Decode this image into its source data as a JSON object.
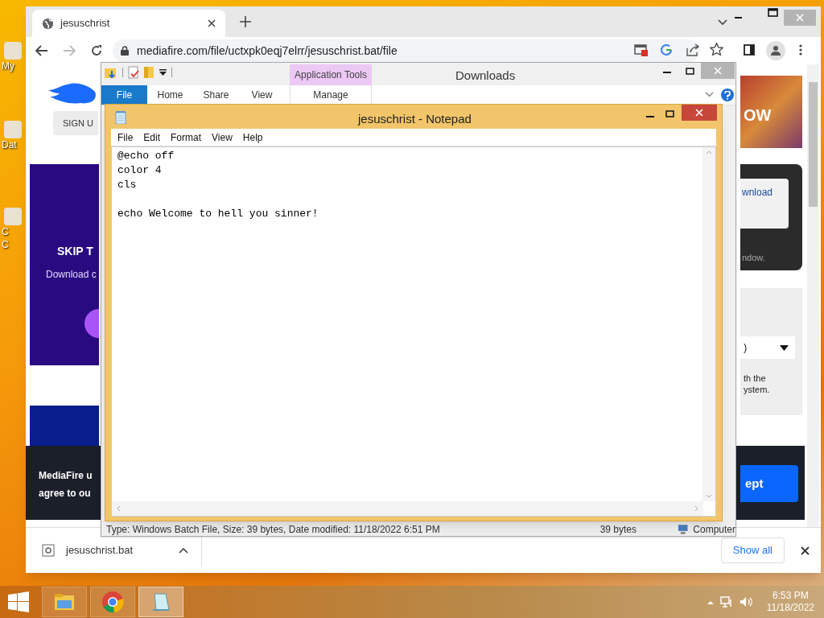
{
  "desktop_icons": [
    {
      "lines": [
        "My"
      ]
    },
    {
      "lines": [
        "Dat"
      ]
    },
    {
      "lines": [
        "C",
        "C"
      ]
    }
  ],
  "browser": {
    "tab": {
      "title": "jesuschrist",
      "selected": true
    },
    "url": "mediafire.com/file/uctxpk0eqj7elrr/jesuschrist.bat/file",
    "page": {
      "sign_up": "SIGN U",
      "promo_title": "SKIP T",
      "promo_text": "Download c",
      "cookie_text": [
        "MediaFire u",
        "agree to ou"
      ],
      "banner_text": "OW",
      "download_link": "wnload",
      "note": "ndow.",
      "select_value": ")",
      "info_text": [
        "th the",
        "ystem."
      ],
      "accept_button": "ept"
    },
    "downloads_bar": {
      "file": "jesuschrist.bat",
      "show_all": "Show all"
    }
  },
  "explorer": {
    "title": "Downloads",
    "tabs": [
      {
        "label": "File",
        "selected": true
      },
      {
        "label": "Home",
        "selected": false
      },
      {
        "label": "Share",
        "selected": false
      },
      {
        "label": "View",
        "selected": false
      }
    ],
    "context_group": "Application Tools",
    "context_tab": "Manage",
    "status": {
      "details": "Type: Windows Batch File, Size: 39 bytes, Date modified: 11/18/2022 6:51 PM",
      "size": "39 bytes",
      "location": "Computer"
    }
  },
  "notepad": {
    "title": "jesuschrist - Notepad",
    "menu": [
      "File",
      "Edit",
      "Format",
      "View",
      "Help"
    ],
    "text": "@echo off\ncolor 4\ncls\n\necho Welcome to hell you sinner!"
  },
  "taskbar": {
    "apps": [
      {
        "kind": "explorer",
        "selected": false
      },
      {
        "kind": "chrome",
        "selected": false
      },
      {
        "kind": "notepad",
        "selected": true
      }
    ],
    "time": "6:53 PM",
    "date": "11/18/2022"
  }
}
